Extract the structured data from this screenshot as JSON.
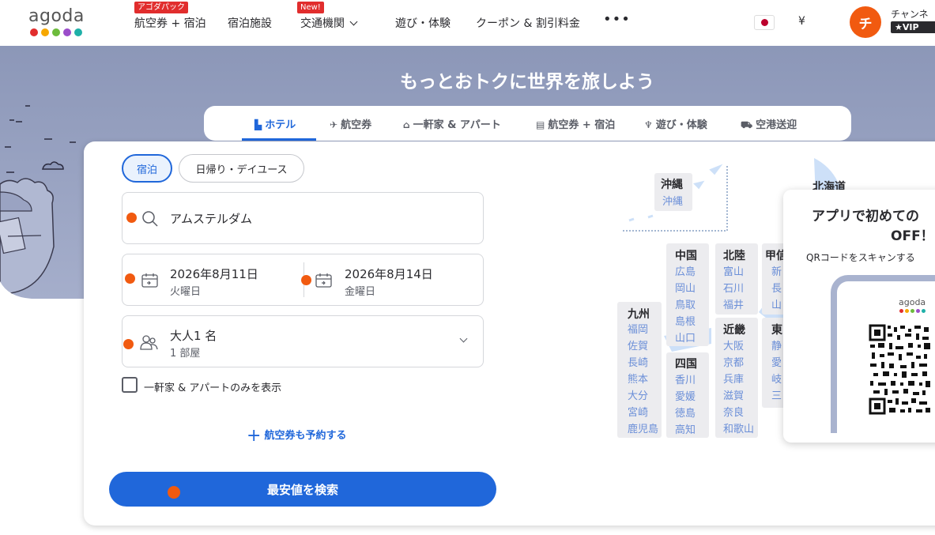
{
  "header": {
    "logo": "agoda",
    "logo_colors": [
      "#e12d2d",
      "#f7a800",
      "#6cbb3c",
      "#2067da",
      "#9b4dca",
      "#1fb0a8"
    ],
    "nav": [
      {
        "label": "航空券 + 宿泊",
        "badge": "アゴダパック"
      },
      {
        "label": "宿泊施設"
      },
      {
        "label": "交通機関",
        "badge": "New!"
      },
      {
        "label": "遊び・体験"
      },
      {
        "label": "クーポン & 割引料金"
      }
    ],
    "more": "•••",
    "currency": "¥",
    "avatar_initial": "チ",
    "user_name": "チャンネ",
    "vip": "★VIP"
  },
  "hero": {
    "title": "もっとおトクに世界を旅しよう"
  },
  "tabs": [
    {
      "label": "ホテル",
      "icon": "hotel-icon",
      "active": true
    },
    {
      "label": "航空券",
      "icon": "plane-icon"
    },
    {
      "label": "一軒家 & アパート",
      "icon": "house-icon"
    },
    {
      "label": "航空券 + 宿泊",
      "icon": "package-icon"
    },
    {
      "label": "遊び・体験",
      "icon": "activity-icon"
    },
    {
      "label": "空港送迎",
      "icon": "car-icon"
    }
  ],
  "search": {
    "stay_types": [
      "宿泊",
      "日帰り・デイユース"
    ],
    "destination": "アムステルダム",
    "checkin_date": "2026年8月11日",
    "checkin_day": "火曜日",
    "checkout_date": "2026年8月14日",
    "checkout_day": "金曜日",
    "guests": "大人1 名",
    "rooms": "1 部屋",
    "homes_only_label": "一軒家 & アパートのみを表示",
    "add_flight_label": "航空券も予約する",
    "search_button": "最安値を検索"
  },
  "map": {
    "okinawa": {
      "name": "沖縄",
      "prefs": [
        "沖縄"
      ]
    },
    "hokkaido": {
      "name": "北海道"
    },
    "chugoku": {
      "name": "中国",
      "prefs": [
        "広島",
        "岡山",
        "鳥取",
        "島根",
        "山口"
      ]
    },
    "hokuriku": {
      "name": "北陸",
      "prefs": [
        "富山",
        "石川",
        "福井"
      ]
    },
    "koshinetsu": {
      "name": "甲信",
      "prefs": [
        "新",
        "長",
        "山"
      ]
    },
    "kyushu": {
      "name": "九州",
      "prefs": [
        "福岡",
        "佐賀",
        "長崎",
        "熊本",
        "大分",
        "宮崎",
        "鹿児島"
      ]
    },
    "shikoku": {
      "name": "四国",
      "prefs": [
        "香川",
        "愛媛",
        "徳島",
        "高知"
      ]
    },
    "kinki": {
      "name": "近畿",
      "prefs": [
        "大阪",
        "京都",
        "兵庫",
        "滋賀",
        "奈良",
        "和歌山"
      ]
    },
    "tokai": {
      "name": "東",
      "prefs": [
        "静",
        "愛",
        "岐",
        "三"
      ]
    }
  },
  "popup": {
    "title_line1": "アプリで初めての",
    "title_line2": "OFF！",
    "subtitle": "QRコードをスキャンする",
    "phone_logo": "agoda"
  }
}
